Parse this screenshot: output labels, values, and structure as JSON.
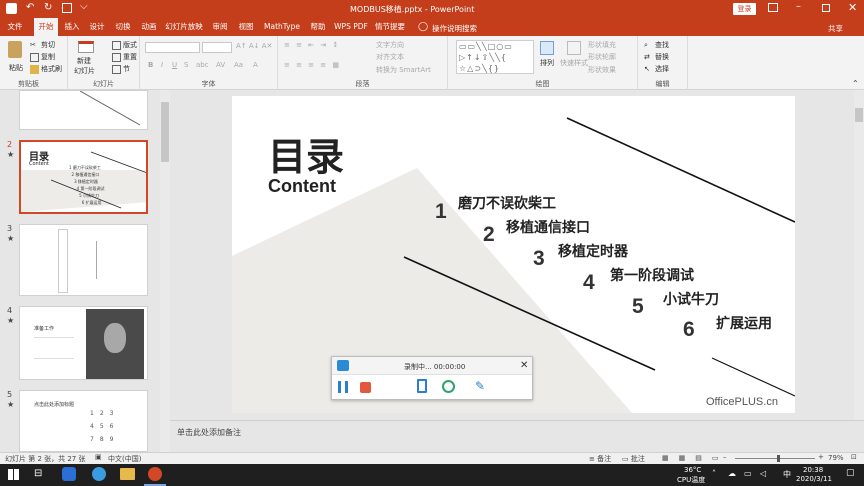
{
  "titlebar": {
    "title": "MODBUS移植.pptx - PowerPoint",
    "login": "登录"
  },
  "tabs": [
    "文件",
    "开始",
    "插入",
    "设计",
    "切换",
    "动画",
    "幻灯片放映",
    "审阅",
    "视图",
    "MathType",
    "帮助",
    "WPS PDF",
    "情节提要"
  ],
  "tell_me": "操作说明搜索",
  "share": "共享",
  "ribbon": {
    "clipboard": {
      "paste": "粘贴",
      "cut": "剪切",
      "copy": "复制",
      "format_painter": "格式刷",
      "label": "剪贴板"
    },
    "slides": {
      "new_slide": "新建",
      "new_slide2": "幻灯片",
      "layout": "版式",
      "reset": "重置",
      "section": "节",
      "label": "幻灯片"
    },
    "font": {
      "label": "字体"
    },
    "paragraph": {
      "text_direction": "文字方向",
      "align_text": "对齐文本",
      "smartart": "转换为 SmartArt",
      "label": "段落"
    },
    "drawing": {
      "arrange": "排列",
      "quick_styles": "快速样式",
      "fill": "形状填充",
      "outline": "形状轮廓",
      "effects": "形状效果",
      "label": "绘图"
    },
    "editing": {
      "find": "查找",
      "replace": "替换",
      "select": "选择",
      "label": "编辑"
    }
  },
  "thumbnails": [
    {
      "num": "2",
      "title": "目录",
      "sub": "Content"
    },
    {
      "num": "3"
    },
    {
      "num": "4",
      "title": "准备工作"
    },
    {
      "num": "5",
      "title": "点击此处添加标题"
    }
  ],
  "slide": {
    "title": "目录",
    "subtitle": "Content",
    "items": [
      {
        "num": "1",
        "text": "磨刀不误砍柴工"
      },
      {
        "num": "2",
        "text": "移植通信接口"
      },
      {
        "num": "3",
        "text": "移植定时器"
      },
      {
        "num": "4",
        "text": "第一阶段调试"
      },
      {
        "num": "5",
        "text": "小试牛刀"
      },
      {
        "num": "6",
        "text": "扩展运用"
      }
    ],
    "watermark": "OfficePLUS.cn"
  },
  "recorder": {
    "status": "录制中... 00:00:00"
  },
  "notes_placeholder": "单击此处添加备注",
  "status": {
    "slide_info": "幻灯片 第 2 张，共 27 张",
    "language": "中文(中国)",
    "notes": "备注",
    "comments": "批注",
    "zoom": "79%"
  },
  "taskbar": {
    "temp": "36°C",
    "cpu": "CPU温度",
    "time": "20:38",
    "date": "2020/3/11",
    "ime": "中"
  },
  "colors": {
    "accent": "#c43e1c",
    "selected_thumb": "#d24726"
  }
}
